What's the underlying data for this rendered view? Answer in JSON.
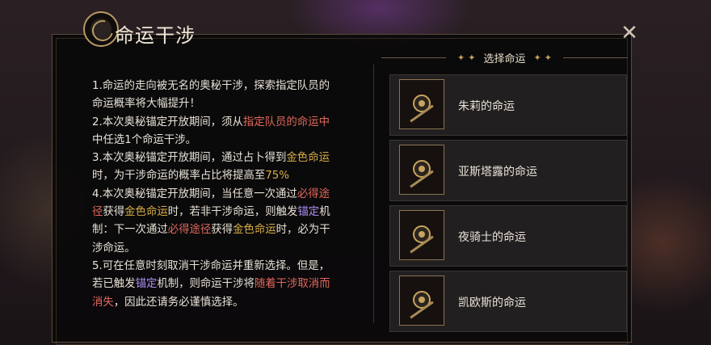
{
  "dialog": {
    "title": "命运干涉",
    "close_symbol": "✕"
  },
  "description": {
    "lines": [
      [
        {
          "t": "1.命运的走向被无名的奥秘干涉，探索指定队员的命运概率将大幅提升！",
          "c": ""
        }
      ],
      [
        {
          "t": "2.本次奥秘锚定开放期间，须从",
          "c": ""
        },
        {
          "t": "指定队员的命运中",
          "c": "red"
        },
        {
          "t": "中任选1个命运干涉。",
          "c": ""
        }
      ],
      [
        {
          "t": "3.本次奥秘锚定开放期间，通过占卜得到",
          "c": ""
        },
        {
          "t": "金色命运",
          "c": "gold"
        },
        {
          "t": "时，为干涉命运的概率占比将提高至",
          "c": ""
        },
        {
          "t": "75%",
          "c": "gold"
        }
      ],
      [
        {
          "t": "4.本次奥秘锚定开放期间，当任意一次通过",
          "c": ""
        },
        {
          "t": "必得途径",
          "c": "red"
        },
        {
          "t": "获得",
          "c": ""
        },
        {
          "t": "金色命运",
          "c": "gold"
        },
        {
          "t": "时，若非干涉命运，则触发",
          "c": ""
        },
        {
          "t": "锚定",
          "c": "purple"
        },
        {
          "t": "机制：下一次通过",
          "c": ""
        },
        {
          "t": "必得途径",
          "c": "red"
        },
        {
          "t": "获得",
          "c": ""
        },
        {
          "t": "金色命运",
          "c": "gold"
        },
        {
          "t": "时，必为干涉命运。",
          "c": ""
        }
      ],
      [
        {
          "t": "5.可在任意时刻取消干涉命运并重新选择。但是，若已触发",
          "c": ""
        },
        {
          "t": "锚定",
          "c": "purple"
        },
        {
          "t": "机制，则命运干涉将",
          "c": ""
        },
        {
          "t": "随着干涉取消而消失",
          "c": "red"
        },
        {
          "t": "，因此还请务必谨慎选择。",
          "c": ""
        }
      ]
    ]
  },
  "chooser": {
    "title": "选择命运",
    "decor": "✦",
    "items": [
      {
        "label": "朱莉的命运",
        "icon": "fate-card-icon"
      },
      {
        "label": "亚斯塔露的命运",
        "icon": "fate-card-icon"
      },
      {
        "label": "夜骑士的命运",
        "icon": "fate-card-icon"
      },
      {
        "label": "凯欧斯的命运",
        "icon": "fate-card-icon"
      }
    ]
  },
  "colors": {
    "gold": "#d8ad48",
    "red": "#e0675a",
    "purple": "#a98bf0",
    "text": "#e8e2d7"
  }
}
